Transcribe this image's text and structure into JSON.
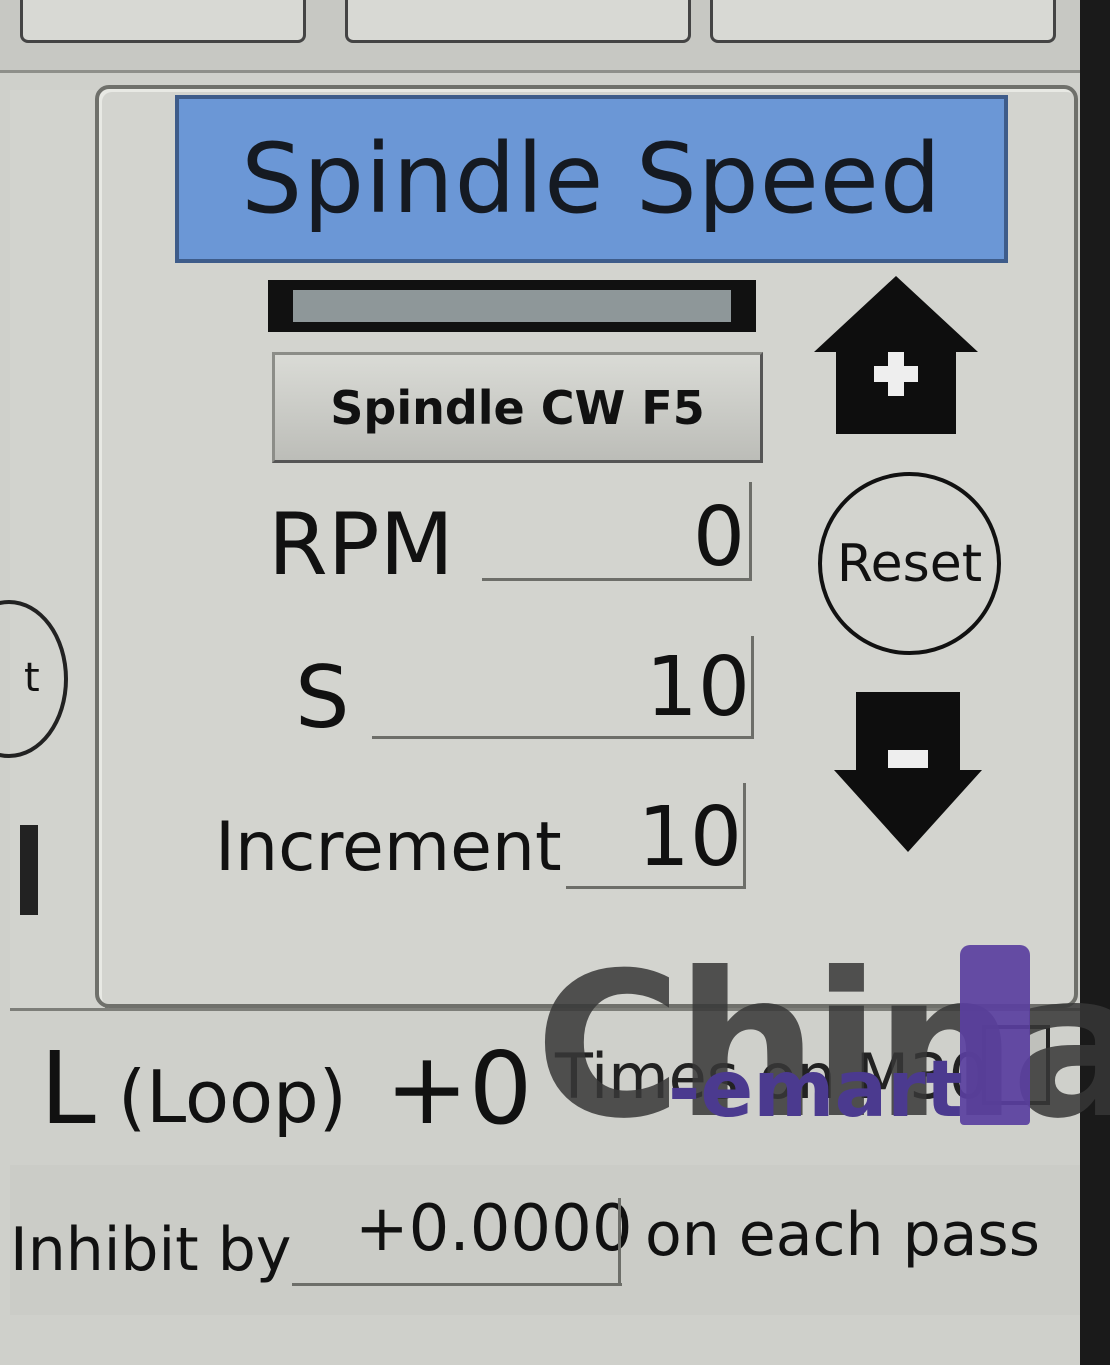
{
  "panel": {
    "title": "Spindle Speed"
  },
  "spindle_button": {
    "label": "Spindle CW F5"
  },
  "speed_bar": {
    "fill_fraction": 1.0,
    "color": "#8e9799"
  },
  "fields": {
    "rpm": {
      "label": "RPM",
      "value": "0"
    },
    "s": {
      "label": "S",
      "value": "10"
    },
    "increment": {
      "label": "Increment",
      "value": "10"
    }
  },
  "controls": {
    "increase_icon": "plus-arrow-up-icon",
    "reset_label": "Reset",
    "decrease_icon": "minus-arrow-down-icon"
  },
  "loop_row": {
    "letter": "L",
    "label": "(Loop)",
    "value": "+0",
    "times_label": "Times on M30"
  },
  "inhibit_row": {
    "label": "Inhibit by",
    "value": "+0.0000",
    "suffix": "on each pass"
  },
  "left_panel": {
    "partial_button_text": "t"
  },
  "watermark": {
    "brand": "China",
    "sub": "-emart",
    "digit": "1"
  },
  "colors": {
    "title_bg": "#6b97d6",
    "panel_bg": "#d3d4cf",
    "watermark": "#5a3fa0"
  }
}
